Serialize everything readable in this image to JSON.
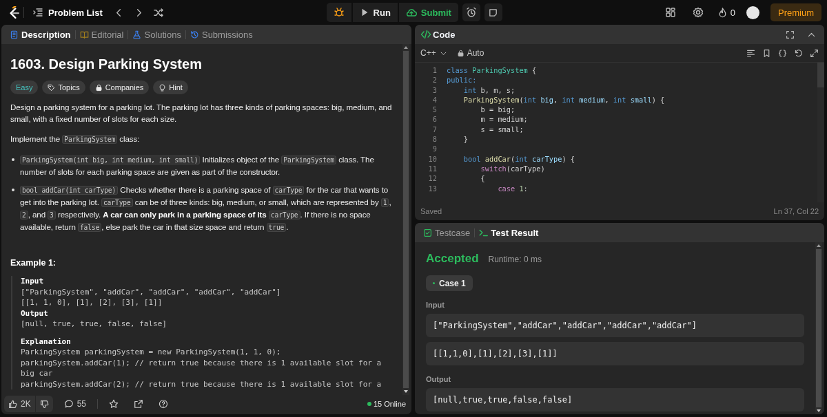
{
  "topbar": {
    "problem_list": "Problem List",
    "run": "Run",
    "submit": "Submit",
    "streak": "0",
    "premium": "Premium"
  },
  "description_panel": {
    "tabs": [
      {
        "label": "Description",
        "kind": "doc",
        "selected": true
      },
      {
        "label": "Editorial",
        "kind": "book",
        "selected": false
      },
      {
        "label": "Solutions",
        "kind": "flask",
        "selected": false
      },
      {
        "label": "Submissions",
        "kind": "history",
        "selected": false
      }
    ],
    "title": "1603. Design Parking System",
    "tags": [
      {
        "label": "Easy",
        "kind": "difficulty"
      },
      {
        "label": "Topics",
        "kind": "tag"
      },
      {
        "label": "Companies",
        "kind": "lock"
      },
      {
        "label": "Hint",
        "kind": "bulb"
      }
    ],
    "blocks": [
      {
        "kind": "para",
        "parts": [
          {
            "kind": "text",
            "text": "Design a parking system for a parking lot. The parking lot has three kinds of parking spaces: big, medium, and small, with a fixed number of slots for each size."
          }
        ]
      },
      {
        "kind": "para",
        "parts": [
          {
            "kind": "text",
            "text": "Implement the "
          },
          {
            "kind": "code",
            "text": "ParkingSystem"
          },
          {
            "kind": "text",
            "text": " class:"
          }
        ]
      },
      {
        "kind": "bullet",
        "parts": [
          {
            "kind": "code",
            "text": "ParkingSystem(int big, int medium, int small)"
          },
          {
            "kind": "text",
            "text": " Initializes object of the "
          },
          {
            "kind": "code",
            "text": "ParkingSystem"
          },
          {
            "kind": "text",
            "text": " class. The number of slots for each parking space are given as part of the constructor."
          }
        ]
      },
      {
        "kind": "bullet",
        "parts": [
          {
            "kind": "code",
            "text": "bool addCar(int carType)"
          },
          {
            "kind": "text",
            "text": " Checks whether there is a parking space of "
          },
          {
            "kind": "code",
            "text": "carType"
          },
          {
            "kind": "text",
            "text": " for the car that wants to get into the parking lot. "
          },
          {
            "kind": "code",
            "text": "carType"
          },
          {
            "kind": "text",
            "text": " can be of three kinds: big, medium, or small, which are represented by "
          },
          {
            "kind": "code",
            "text": "1"
          },
          {
            "kind": "text",
            "text": ", "
          },
          {
            "kind": "code",
            "text": "2"
          },
          {
            "kind": "text",
            "text": ", and "
          },
          {
            "kind": "code",
            "text": "3"
          },
          {
            "kind": "text",
            "text": " respectively. "
          },
          {
            "kind": "bold",
            "text": "A car can only park in a parking space of its "
          },
          {
            "kind": "code",
            "text": "carType"
          },
          {
            "kind": "text",
            "text": ". If there is no space available, return "
          },
          {
            "kind": "code",
            "text": "false"
          },
          {
            "kind": "text",
            "text": ", else park the car in that size space and return "
          },
          {
            "kind": "code",
            "text": "true"
          },
          {
            "kind": "text",
            "text": "."
          }
        ]
      }
    ],
    "example_title": "Example 1:",
    "example_lines": [
      {
        "kind": "label",
        "text": "Input"
      },
      {
        "kind": "value",
        "text": "[\"ParkingSystem\", \"addCar\", \"addCar\", \"addCar\", \"addCar\"]"
      },
      {
        "kind": "value",
        "text": "[[1, 1, 0], [1], [2], [3], [1]]"
      },
      {
        "kind": "label",
        "text": "Output"
      },
      {
        "kind": "value",
        "text": "[null, true, true, false, false]"
      },
      {
        "kind": "label",
        "text": "Explanation",
        "spaced": true
      },
      {
        "kind": "value",
        "text": "ParkingSystem parkingSystem = new ParkingSystem(1, 1, 0);"
      },
      {
        "kind": "value",
        "text": "parkingSystem.addCar(1); // return true because there is 1 available slot for a big car"
      },
      {
        "kind": "value",
        "text": "parkingSystem.addCar(2); // return true because there is 1 available slot for a"
      }
    ],
    "footer": {
      "likes": "2K",
      "comments": "55",
      "online": "15 Online"
    }
  },
  "code_panel": {
    "title": "Code",
    "language": "C++",
    "mode": "Auto",
    "lines": [
      {
        "num": "1",
        "tokens": [
          {
            "kind": "kw",
            "t": "class "
          },
          {
            "kind": "type",
            "t": "ParkingSystem"
          },
          {
            "kind": "plain",
            "t": " {"
          }
        ]
      },
      {
        "num": "2",
        "tokens": [
          {
            "kind": "kw",
            "t": "public:"
          }
        ]
      },
      {
        "num": "3",
        "tokens": [
          {
            "kind": "kw",
            "t": "    int"
          },
          {
            "kind": "plain",
            "t": " b, m, s;"
          }
        ]
      },
      {
        "num": "4",
        "tokens": [
          {
            "kind": "fn",
            "t": "    ParkingSystem"
          },
          {
            "kind": "plain",
            "t": "("
          },
          {
            "kind": "kw",
            "t": "int"
          },
          {
            "kind": "param",
            "t": " big"
          },
          {
            "kind": "plain",
            "t": ", "
          },
          {
            "kind": "kw",
            "t": "int"
          },
          {
            "kind": "param",
            "t": " medium"
          },
          {
            "kind": "plain",
            "t": ", "
          },
          {
            "kind": "kw",
            "t": "int"
          },
          {
            "kind": "param",
            "t": " small"
          },
          {
            "kind": "plain",
            "t": ") {"
          }
        ]
      },
      {
        "num": "5",
        "tokens": [
          {
            "kind": "plain",
            "t": "        b = big;"
          }
        ]
      },
      {
        "num": "6",
        "tokens": [
          {
            "kind": "plain",
            "t": "        m = medium;"
          }
        ]
      },
      {
        "num": "7",
        "tokens": [
          {
            "kind": "plain",
            "t": "        s = small;"
          }
        ]
      },
      {
        "num": "8",
        "tokens": [
          {
            "kind": "plain",
            "t": "    }"
          }
        ]
      },
      {
        "num": "9"
      },
      {
        "num": "10",
        "tokens": [
          {
            "kind": "kw",
            "t": "    bool"
          },
          {
            "kind": "fn",
            "t": " addCar"
          },
          {
            "kind": "plain",
            "t": "("
          },
          {
            "kind": "kw",
            "t": "int"
          },
          {
            "kind": "param",
            "t": " carType"
          },
          {
            "kind": "plain",
            "t": ") {"
          }
        ]
      },
      {
        "num": "11",
        "tokens": [
          {
            "kind": "ctrl",
            "t": "        switch"
          },
          {
            "kind": "plain",
            "t": "(carType)"
          }
        ]
      },
      {
        "num": "12",
        "tokens": [
          {
            "kind": "plain",
            "t": "        {"
          }
        ]
      },
      {
        "num": "13",
        "tokens": [
          {
            "kind": "ctrl",
            "t": "            case"
          },
          {
            "kind": "num",
            "t": " 1"
          },
          {
            "kind": "plain",
            "t": ":"
          }
        ]
      }
    ],
    "status": "Saved",
    "cursor": "Ln 37, Col 22"
  },
  "test_panel": {
    "tabs": [
      {
        "label": "Testcase",
        "kind": "check",
        "selected": false
      },
      {
        "label": "Test Result",
        "kind": "terminal",
        "selected": true
      }
    ],
    "verdict": "Accepted",
    "runtime": "Runtime: 0 ms",
    "cases": [
      {
        "label": "Case 1",
        "selected": true
      }
    ],
    "input_label": "Input",
    "inputs": [
      "[\"ParkingSystem\",\"addCar\",\"addCar\",\"addCar\",\"addCar\"]",
      "[[1,1,0],[1],[2],[3],[1]]"
    ],
    "output_label": "Output",
    "output": "[null,true,true,false,false]"
  }
}
